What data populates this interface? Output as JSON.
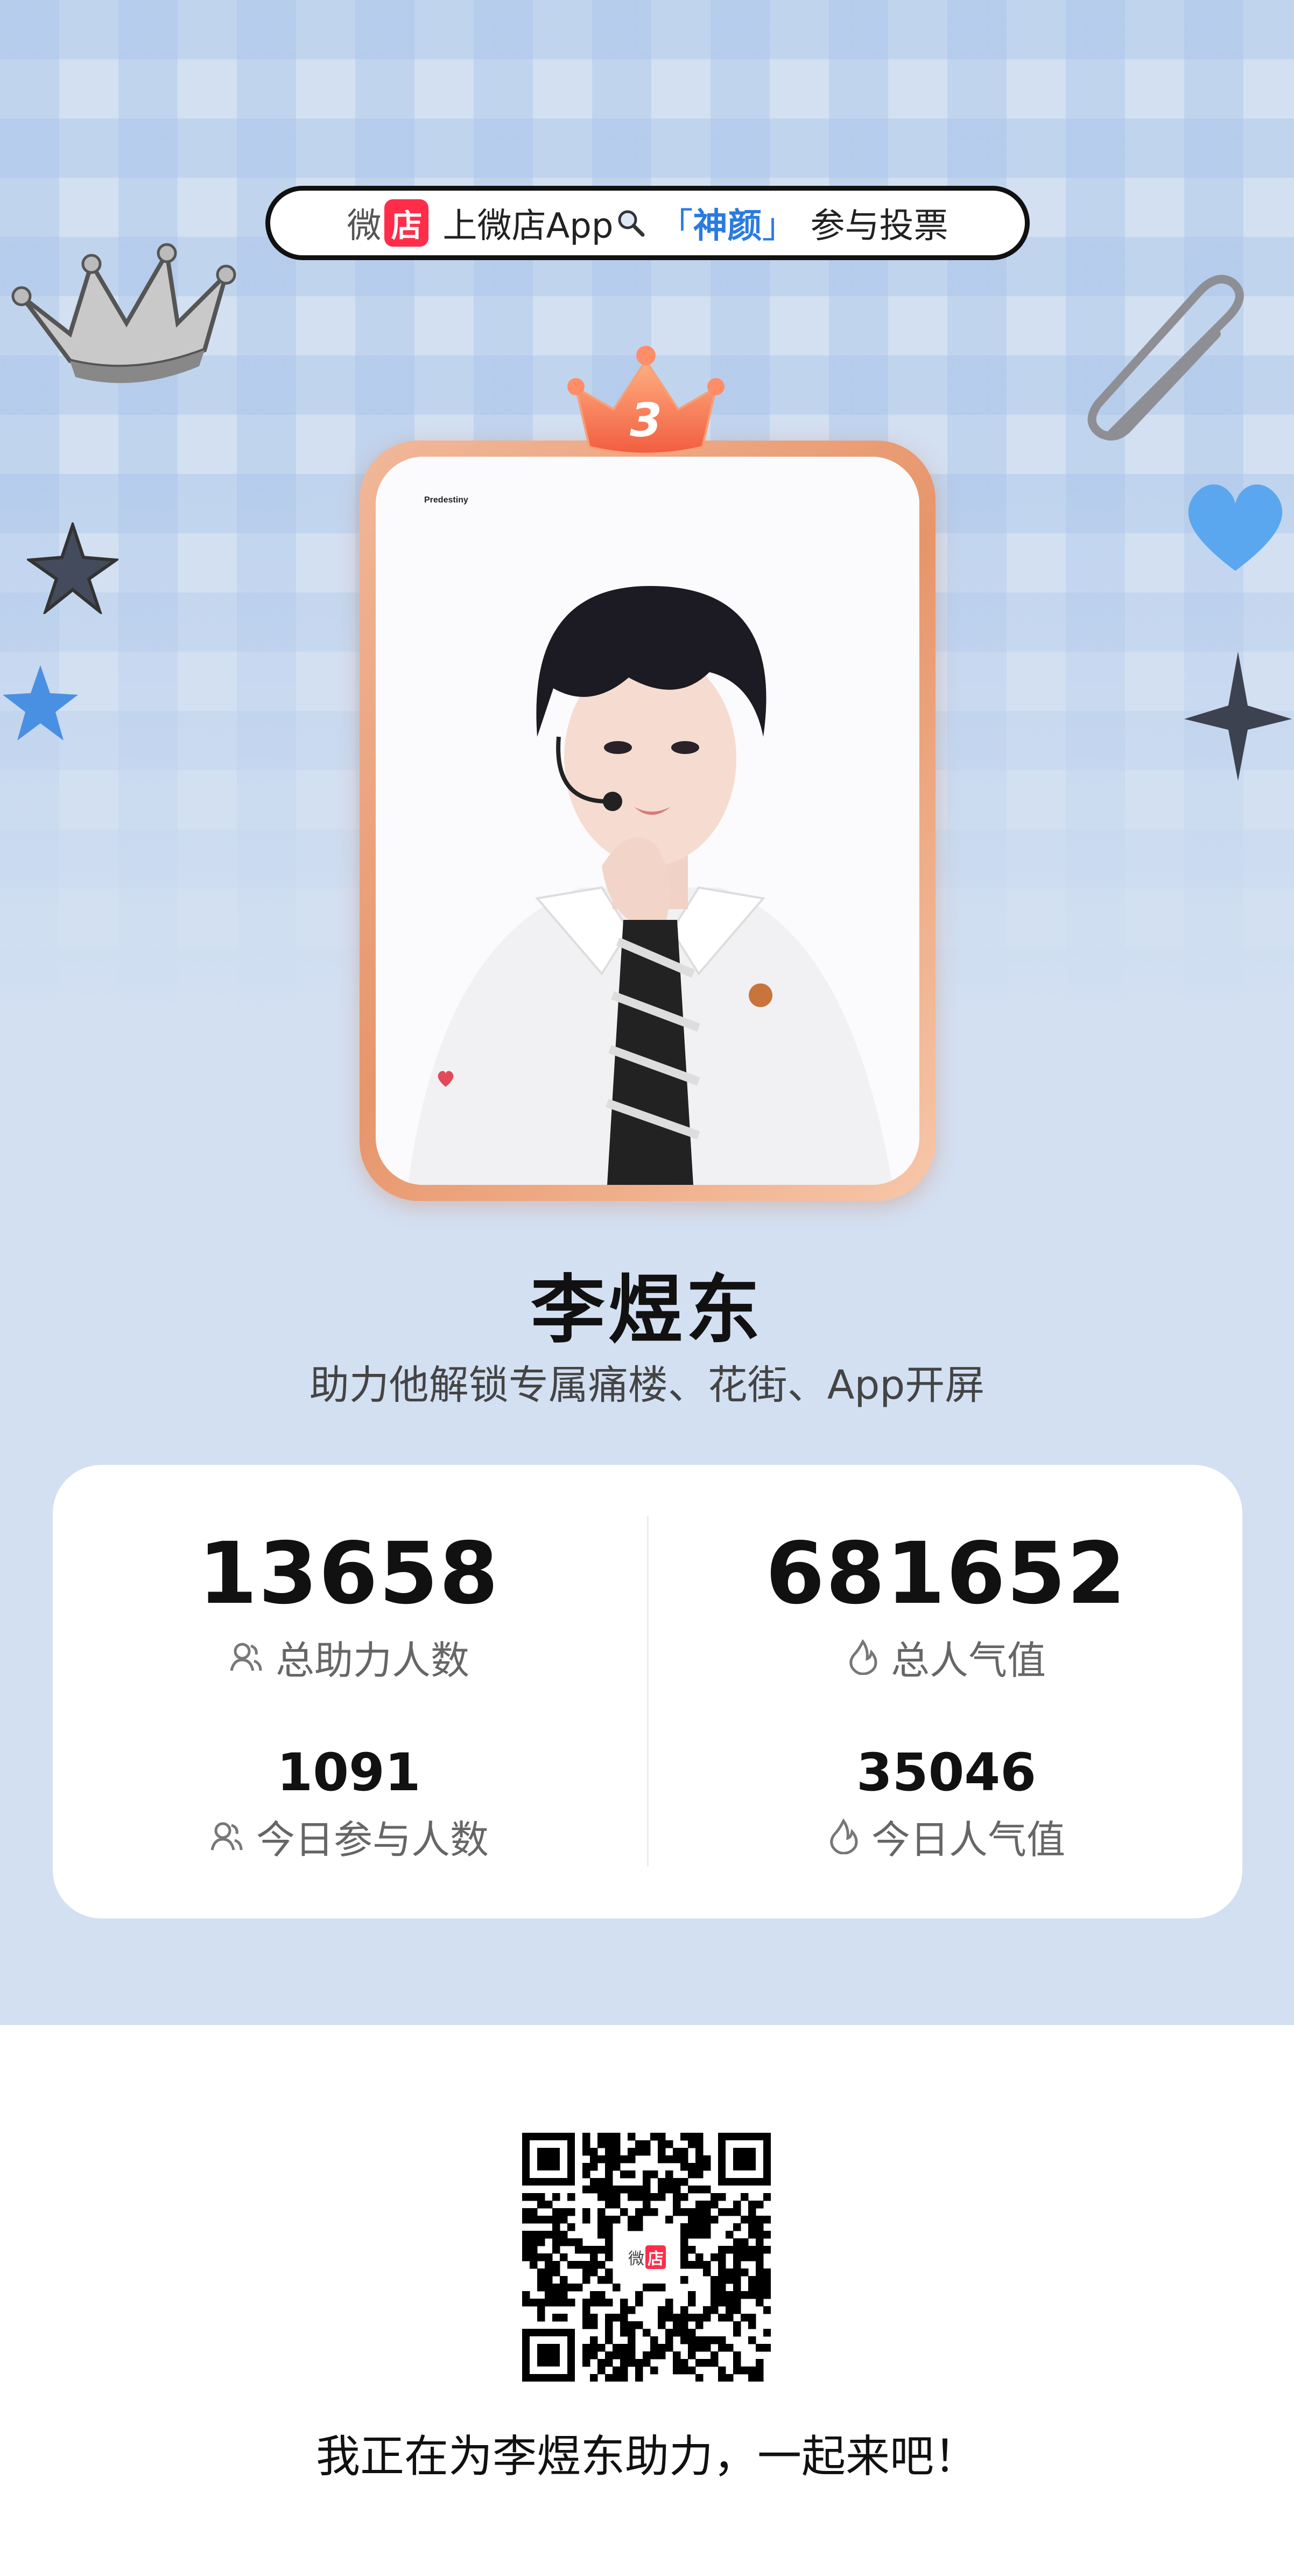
{
  "banner": {
    "logo_wei": "微",
    "logo_dian": "店",
    "text_before": "上微店App",
    "bracket_open": "「",
    "keyword": "神颜",
    "bracket_close": "」",
    "text_after": "参与投票"
  },
  "rank_badge": {
    "number": "3"
  },
  "photo": {
    "watermark": "Predestiny",
    "description": "portrait-photo"
  },
  "profile": {
    "name": "李煜东",
    "subtitle": "助力他解锁专属痛楼、花街、App开屏"
  },
  "stats": {
    "total_supporters": {
      "value": "13658",
      "label": "总助力人数",
      "icon": "people-icon"
    },
    "total_popularity": {
      "value": "681652",
      "label": "总人气值",
      "icon": "flame-icon"
    },
    "today_participants": {
      "value": "1091",
      "label": "今日参与人数",
      "icon": "people-icon"
    },
    "today_popularity": {
      "value": "35046",
      "label": "今日人气值",
      "icon": "flame-icon"
    }
  },
  "qr": {
    "center_logo_wei": "微",
    "center_logo_dian": "店"
  },
  "footer": {
    "text": "我正在为李煜东助力，一起来吧！"
  },
  "colors": {
    "background": "#d3e0f2",
    "accent_blue": "#2a7be0",
    "brand_red": "#ff2d4a",
    "frame_orange": "#e7956a"
  }
}
